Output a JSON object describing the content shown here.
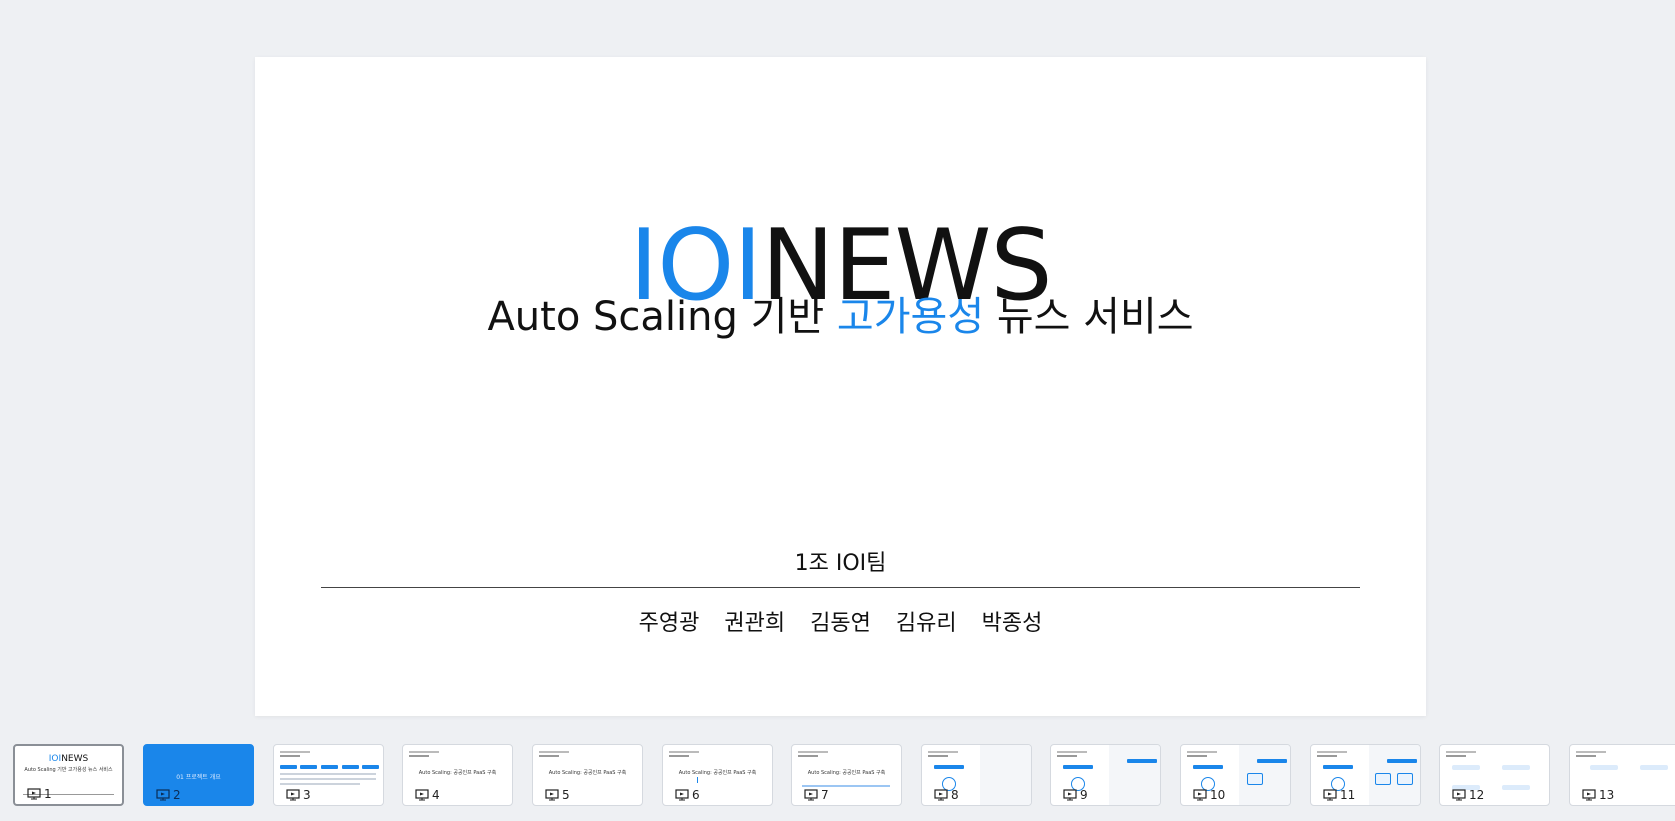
{
  "slide": {
    "logo_ioi": "IOI",
    "logo_news": "NEWS",
    "subtitle_pre": "Auto Scaling 기반 ",
    "subtitle_accent": "고가용성",
    "subtitle_post": " 뉴스 서비스",
    "team": "1조 IOI팀",
    "members": [
      "주영광",
      "권관희",
      "김동연",
      "김유리",
      "박종성"
    ]
  },
  "colors": {
    "accent": "#1a86ea",
    "text": "#111111",
    "background": "#eef0f3"
  },
  "filmstrip": {
    "icon": "presentation-icon",
    "thumbnails": [
      {
        "number": "1",
        "selected": true,
        "logo_ioi": "IOI",
        "logo_news": "NEWS",
        "subtitle": "Auto Scaling 기반 고가용성 뉴스 서비스"
      },
      {
        "number": "2",
        "text": "01 프로젝트 개요"
      },
      {
        "number": "3"
      },
      {
        "number": "4",
        "text": "Auto Scaling: 공공인프 PaaS 구축"
      },
      {
        "number": "5",
        "text": "Auto Scaling: 공공인프 PaaS 구축"
      },
      {
        "number": "6",
        "text": "Auto Scaling: 공공인프 PaaS 구축"
      },
      {
        "number": "7",
        "text": "Auto Scaling: 공공인프 PaaS 구축"
      },
      {
        "number": "8"
      },
      {
        "number": "9"
      },
      {
        "number": "10"
      },
      {
        "number": "11"
      },
      {
        "number": "12"
      },
      {
        "number": "13"
      }
    ]
  }
}
